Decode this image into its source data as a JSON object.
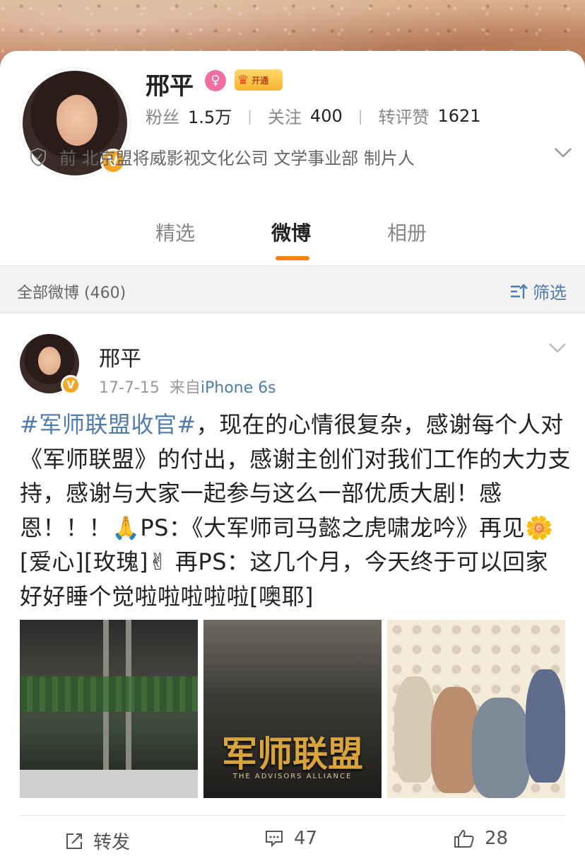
{
  "profile": {
    "name": "邢平",
    "vip_label": "开通",
    "stats": [
      {
        "label": "粉丝",
        "value": "1.5万"
      },
      {
        "label": "关注",
        "value": "400"
      },
      {
        "label": "转评赞",
        "value": "1621"
      }
    ],
    "work": "前 北京盟将威影视文化公司 文学事业部 制片人"
  },
  "tabs": [
    {
      "label": "精选",
      "active": false
    },
    {
      "label": "微博",
      "active": true
    },
    {
      "label": "相册",
      "active": false
    }
  ],
  "filter_bar": {
    "count_label": "全部微博 (460)",
    "filter_label": "筛选"
  },
  "post": {
    "author": "邢平",
    "date": "17-7-15",
    "source_prefix": "来自",
    "device": "iPhone 6s",
    "topic": "#军师联盟收官#",
    "text": "，现在的心情很复杂，感谢每个人对《军师联盟》的付出，感谢主创们对我们工作的大力支持，感谢与大家一起参与这么一部优质大剧！感恩！！！🙏PS：《大军师司马懿之虎啸龙吟》再见🌼[爱心][玫瑰]✌ 再PS：这几个月，今天终于可以回家好好睡个觉啦啦啦啦啦[噢耶]",
    "poster_title": "军师联盟",
    "poster_subtitle": "THE ADVISORS ALLIANCE",
    "actions": {
      "repost_label": "转发",
      "comments": "47",
      "likes": "28"
    }
  },
  "colors": {
    "accent": "#ff8200",
    "link": "#4f7cae",
    "verified": "#f5a623"
  }
}
